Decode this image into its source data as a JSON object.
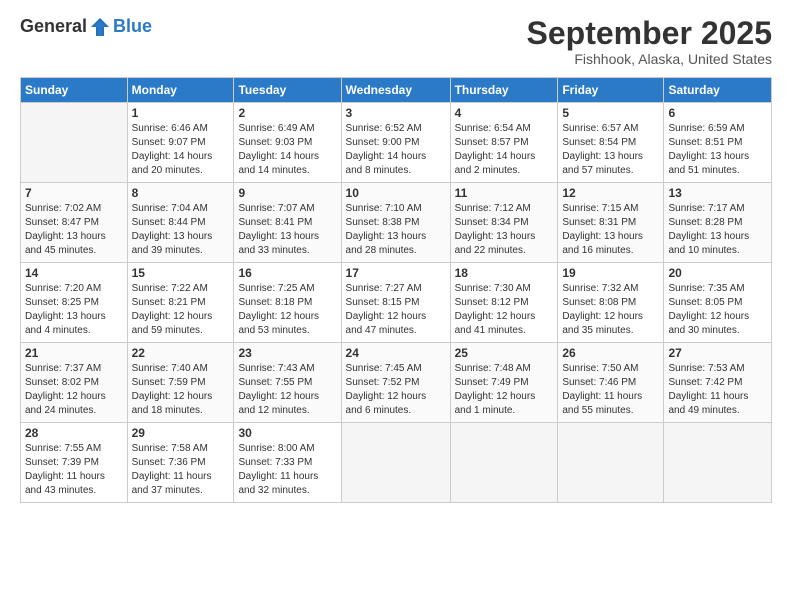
{
  "header": {
    "logo_line1": "General",
    "logo_line2": "Blue",
    "month_title": "September 2025",
    "location": "Fishhook, Alaska, United States"
  },
  "weekdays": [
    "Sunday",
    "Monday",
    "Tuesday",
    "Wednesday",
    "Thursday",
    "Friday",
    "Saturday"
  ],
  "weeks": [
    [
      {
        "day": "",
        "info": ""
      },
      {
        "day": "1",
        "info": "Sunrise: 6:46 AM\nSunset: 9:07 PM\nDaylight: 14 hours\nand 20 minutes."
      },
      {
        "day": "2",
        "info": "Sunrise: 6:49 AM\nSunset: 9:03 PM\nDaylight: 14 hours\nand 14 minutes."
      },
      {
        "day": "3",
        "info": "Sunrise: 6:52 AM\nSunset: 9:00 PM\nDaylight: 14 hours\nand 8 minutes."
      },
      {
        "day": "4",
        "info": "Sunrise: 6:54 AM\nSunset: 8:57 PM\nDaylight: 14 hours\nand 2 minutes."
      },
      {
        "day": "5",
        "info": "Sunrise: 6:57 AM\nSunset: 8:54 PM\nDaylight: 13 hours\nand 57 minutes."
      },
      {
        "day": "6",
        "info": "Sunrise: 6:59 AM\nSunset: 8:51 PM\nDaylight: 13 hours\nand 51 minutes."
      }
    ],
    [
      {
        "day": "7",
        "info": "Sunrise: 7:02 AM\nSunset: 8:47 PM\nDaylight: 13 hours\nand 45 minutes."
      },
      {
        "day": "8",
        "info": "Sunrise: 7:04 AM\nSunset: 8:44 PM\nDaylight: 13 hours\nand 39 minutes."
      },
      {
        "day": "9",
        "info": "Sunrise: 7:07 AM\nSunset: 8:41 PM\nDaylight: 13 hours\nand 33 minutes."
      },
      {
        "day": "10",
        "info": "Sunrise: 7:10 AM\nSunset: 8:38 PM\nDaylight: 13 hours\nand 28 minutes."
      },
      {
        "day": "11",
        "info": "Sunrise: 7:12 AM\nSunset: 8:34 PM\nDaylight: 13 hours\nand 22 minutes."
      },
      {
        "day": "12",
        "info": "Sunrise: 7:15 AM\nSunset: 8:31 PM\nDaylight: 13 hours\nand 16 minutes."
      },
      {
        "day": "13",
        "info": "Sunrise: 7:17 AM\nSunset: 8:28 PM\nDaylight: 13 hours\nand 10 minutes."
      }
    ],
    [
      {
        "day": "14",
        "info": "Sunrise: 7:20 AM\nSunset: 8:25 PM\nDaylight: 13 hours\nand 4 minutes."
      },
      {
        "day": "15",
        "info": "Sunrise: 7:22 AM\nSunset: 8:21 PM\nDaylight: 12 hours\nand 59 minutes."
      },
      {
        "day": "16",
        "info": "Sunrise: 7:25 AM\nSunset: 8:18 PM\nDaylight: 12 hours\nand 53 minutes."
      },
      {
        "day": "17",
        "info": "Sunrise: 7:27 AM\nSunset: 8:15 PM\nDaylight: 12 hours\nand 47 minutes."
      },
      {
        "day": "18",
        "info": "Sunrise: 7:30 AM\nSunset: 8:12 PM\nDaylight: 12 hours\nand 41 minutes."
      },
      {
        "day": "19",
        "info": "Sunrise: 7:32 AM\nSunset: 8:08 PM\nDaylight: 12 hours\nand 35 minutes."
      },
      {
        "day": "20",
        "info": "Sunrise: 7:35 AM\nSunset: 8:05 PM\nDaylight: 12 hours\nand 30 minutes."
      }
    ],
    [
      {
        "day": "21",
        "info": "Sunrise: 7:37 AM\nSunset: 8:02 PM\nDaylight: 12 hours\nand 24 minutes."
      },
      {
        "day": "22",
        "info": "Sunrise: 7:40 AM\nSunset: 7:59 PM\nDaylight: 12 hours\nand 18 minutes."
      },
      {
        "day": "23",
        "info": "Sunrise: 7:43 AM\nSunset: 7:55 PM\nDaylight: 12 hours\nand 12 minutes."
      },
      {
        "day": "24",
        "info": "Sunrise: 7:45 AM\nSunset: 7:52 PM\nDaylight: 12 hours\nand 6 minutes."
      },
      {
        "day": "25",
        "info": "Sunrise: 7:48 AM\nSunset: 7:49 PM\nDaylight: 12 hours\nand 1 minute."
      },
      {
        "day": "26",
        "info": "Sunrise: 7:50 AM\nSunset: 7:46 PM\nDaylight: 11 hours\nand 55 minutes."
      },
      {
        "day": "27",
        "info": "Sunrise: 7:53 AM\nSunset: 7:42 PM\nDaylight: 11 hours\nand 49 minutes."
      }
    ],
    [
      {
        "day": "28",
        "info": "Sunrise: 7:55 AM\nSunset: 7:39 PM\nDaylight: 11 hours\nand 43 minutes."
      },
      {
        "day": "29",
        "info": "Sunrise: 7:58 AM\nSunset: 7:36 PM\nDaylight: 11 hours\nand 37 minutes."
      },
      {
        "day": "30",
        "info": "Sunrise: 8:00 AM\nSunset: 7:33 PM\nDaylight: 11 hours\nand 32 minutes."
      },
      {
        "day": "",
        "info": ""
      },
      {
        "day": "",
        "info": ""
      },
      {
        "day": "",
        "info": ""
      },
      {
        "day": "",
        "info": ""
      }
    ]
  ]
}
